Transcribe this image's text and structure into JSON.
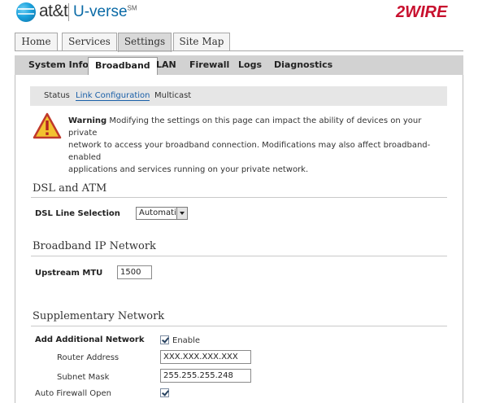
{
  "header": {
    "brand": "at&t",
    "product": "U-verse",
    "product_mark": "SM",
    "vendor": "2WIRE"
  },
  "main_tabs": [
    {
      "label": "Home",
      "active": false
    },
    {
      "label": "Services",
      "active": false
    },
    {
      "label": "Settings",
      "active": true
    },
    {
      "label": "Site Map",
      "active": false
    }
  ],
  "sub_tabs": [
    {
      "label": "System Info",
      "active": false
    },
    {
      "label": "Broadband",
      "active": true
    },
    {
      "label": "LAN",
      "active": false
    },
    {
      "label": "Firewall",
      "active": false
    },
    {
      "label": "Logs",
      "active": false
    },
    {
      "label": "Diagnostics",
      "active": false
    }
  ],
  "links": [
    {
      "label": "Status",
      "active": false
    },
    {
      "label": "Link Configuration",
      "active": true
    },
    {
      "label": "Multicast",
      "active": false
    }
  ],
  "warning": {
    "title": "Warning",
    "line1": " Modifying the settings on this page can impact the ability of devices on your private",
    "line2": "network to access your broadband connection. Modifications may also affect broadband-enabled",
    "line3": "applications and services running on your private network.",
    "icon": "warning-icon"
  },
  "sections": {
    "dsl": {
      "title": "DSL and ATM",
      "line_selection_label": "DSL Line Selection",
      "line_selection_value": "Automatic"
    },
    "broadband_ip": {
      "title": "Broadband IP Network",
      "mtu_label": "Upstream MTU",
      "mtu_value": "1500"
    },
    "supplementary": {
      "title": "Supplementary Network",
      "add_network_label": "Add Additional Network",
      "enable_label": "Enable",
      "enable_checked": true,
      "router_address_label": "Router Address",
      "router_address_value": "XXX.XXX.XXX.XXX",
      "subnet_mask_label": "Subnet Mask",
      "subnet_mask_value": "255.255.255.248",
      "auto_firewall_label": "Auto Firewall Open",
      "auto_firewall_checked": true
    }
  },
  "colors": {
    "att_blue": "#1aa1dc",
    "vendor_red": "#c8102e",
    "link_active": "#1a5fa8",
    "tab_bar": "#d2d2d2"
  }
}
